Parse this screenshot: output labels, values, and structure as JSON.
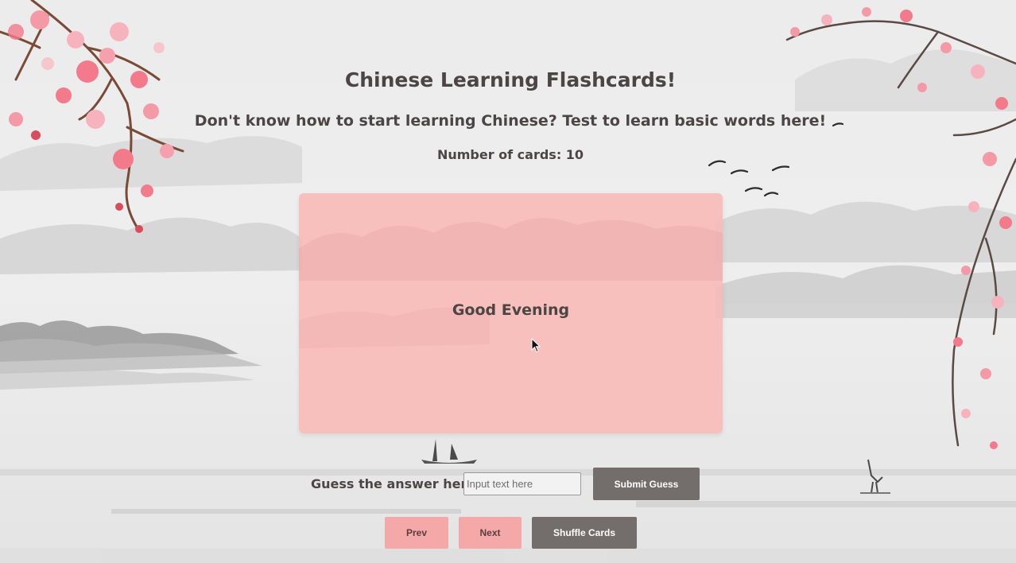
{
  "header": {
    "title": "Chinese Learning Flashcards!",
    "subtitle": "Don't know how to start learning Chinese? Test to learn basic words here!",
    "card_count": "Number of cards: 10"
  },
  "card": {
    "text": "Good Evening"
  },
  "guess": {
    "label": "Guess the answer here:",
    "placeholder": "Input text here",
    "value": "",
    "submit_label": "Submit Guess"
  },
  "nav": {
    "prev_label": "Prev",
    "next_label": "Next",
    "shuffle_label": "Shuffle Cards"
  },
  "colors": {
    "card": "#f8b9b6",
    "pink_button": "#f4a8a7",
    "dark_button": "#736e6c",
    "text": "#4b4645",
    "blossom": "#f27a8a"
  },
  "icons": {
    "cursor": "mouse-pointer-icon"
  }
}
